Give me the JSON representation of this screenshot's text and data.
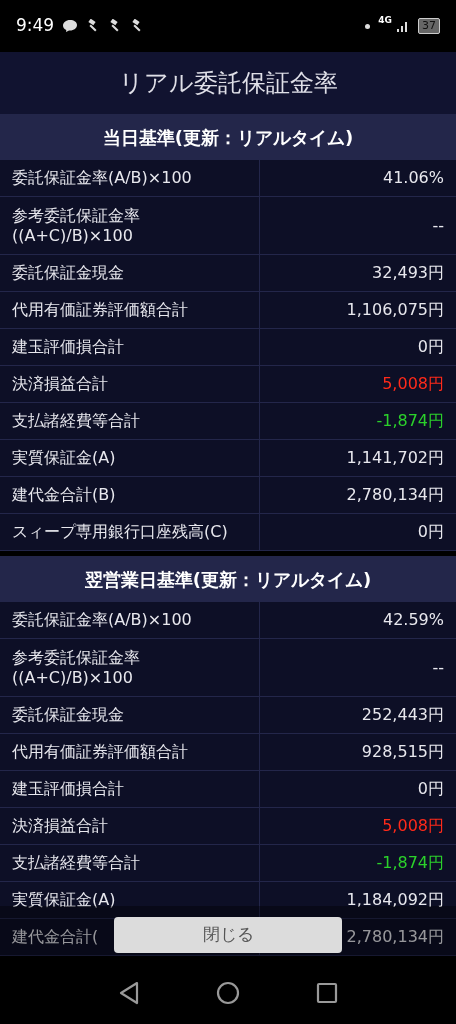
{
  "status_bar": {
    "time": "9:49",
    "network": "4G",
    "battery": "37"
  },
  "title": "リアル委託保証金率",
  "sections": [
    {
      "heading": "当日基準(更新：リアルタイム)",
      "rows": [
        {
          "label": "委託保証金率(A/B)×100",
          "value": "41.06%",
          "kind": "plain"
        },
        {
          "label": "参考委託保証金率\n((A+C)/B)×100",
          "value": "--",
          "kind": "plain"
        },
        {
          "label": "委託保証金現金",
          "value": "32,493円",
          "kind": "plain"
        },
        {
          "label": "代用有価証券評価額合計",
          "value": "1,106,075円",
          "kind": "plain"
        },
        {
          "label": "建玉評価損合計",
          "value": "0円",
          "kind": "plain"
        },
        {
          "label": "決済損益合計",
          "value": "5,008円",
          "kind": "gain"
        },
        {
          "label": "支払諸経費等合計",
          "value": "-1,874円",
          "kind": "loss"
        },
        {
          "label": "実質保証金(A)",
          "value": "1,141,702円",
          "kind": "plain"
        },
        {
          "label": "建代金合計(B)",
          "value": "2,780,134円",
          "kind": "plain"
        },
        {
          "label": "スィープ専用銀行口座残高(C)",
          "value": "0円",
          "kind": "plain"
        }
      ]
    },
    {
      "heading": "翌営業日基準(更新：リアルタイム)",
      "rows": [
        {
          "label": "委託保証金率(A/B)×100",
          "value": "42.59%",
          "kind": "plain"
        },
        {
          "label": "参考委託保証金率\n((A+C)/B)×100",
          "value": "--",
          "kind": "plain"
        },
        {
          "label": "委託保証金現金",
          "value": "252,443円",
          "kind": "plain"
        },
        {
          "label": "代用有価証券評価額合計",
          "value": "928,515円",
          "kind": "plain"
        },
        {
          "label": "建玉評価損合計",
          "value": "0円",
          "kind": "plain"
        },
        {
          "label": "決済損益合計",
          "value": "5,008円",
          "kind": "gain"
        },
        {
          "label": "支払諸経費等合計",
          "value": "-1,874円",
          "kind": "loss"
        },
        {
          "label": "実質保証金(A)",
          "value": "1,184,092円",
          "kind": "plain"
        },
        {
          "label": "建代金合計(",
          "value": "2,780,134円",
          "kind": "plain"
        }
      ]
    }
  ],
  "close_button": "閉じる"
}
